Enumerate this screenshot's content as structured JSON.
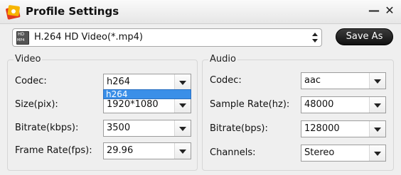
{
  "window": {
    "title": "Profile Settings"
  },
  "format": {
    "value": "H.264 HD Video(*.mp4)",
    "icon": "hd-mp4-icon"
  },
  "toolbar": {
    "save_label": "Save As"
  },
  "video": {
    "group_label": "Video",
    "codec_label": "Codec:",
    "codec_value": "h264",
    "codec_dropdown_option": "h264",
    "size_label": "Size(pix):",
    "size_value": "1920*1080",
    "bitrate_label": "Bitrate(kbps):",
    "bitrate_value": "3500",
    "framerate_label": "Frame Rate(fps):",
    "framerate_value": "29.96"
  },
  "audio": {
    "group_label": "Audio",
    "codec_label": "Codec:",
    "codec_value": "aac",
    "samplerate_label": "Sample Rate(hz):",
    "samplerate_value": "48000",
    "bitrate_label": "Bitrate(bps):",
    "bitrate_value": "128000",
    "channels_label": "Channels:",
    "channels_value": "Stereo"
  }
}
